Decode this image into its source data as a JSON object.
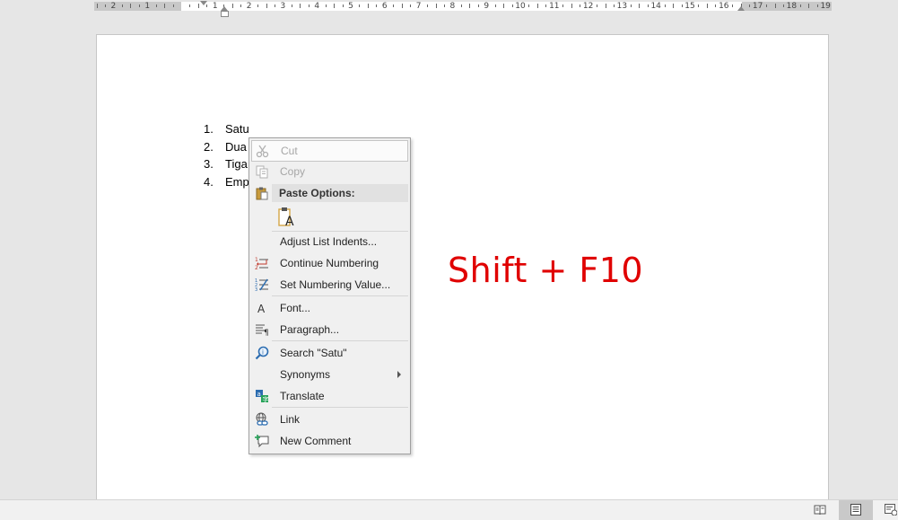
{
  "ruler": {
    "labels": [
      "2",
      "1",
      "1",
      "2",
      "3",
      "4",
      "5",
      "6",
      "7",
      "8",
      "9",
      "10",
      "11",
      "12",
      "13",
      "14",
      "15",
      "16",
      "17",
      "18",
      "19"
    ]
  },
  "document": {
    "list": [
      {
        "num": "1.",
        "text": "Satu"
      },
      {
        "num": "2.",
        "text": "Dua"
      },
      {
        "num": "3.",
        "text": "Tiga"
      },
      {
        "num": "4.",
        "text": "Emp"
      }
    ]
  },
  "annotation": {
    "text": "Shift + F10",
    "color": "#e00000"
  },
  "context_menu": {
    "items": [
      {
        "id": "cut",
        "label": "Cut",
        "icon": "scissors-icon",
        "disabled": true
      },
      {
        "id": "copy",
        "label": "Copy",
        "icon": "copy-icon",
        "disabled": true
      },
      {
        "id": "paste_header",
        "label": "Paste Options:",
        "icon": "clipboard-icon"
      },
      {
        "id": "paste_text_only",
        "label": "",
        "icon": "keep-text-only-icon"
      },
      {
        "id": "adjust",
        "label": "Adjust List Indents...",
        "icon": ""
      },
      {
        "id": "continue",
        "label": "Continue Numbering",
        "icon": "continue-numbering-icon"
      },
      {
        "id": "setvalue",
        "label": "Set Numbering Value...",
        "icon": "set-numbering-value-icon"
      },
      {
        "id": "font",
        "label": "Font...",
        "icon": "font-icon"
      },
      {
        "id": "paragraph",
        "label": "Paragraph...",
        "icon": "paragraph-icon"
      },
      {
        "id": "search",
        "label": "Search \"Satu\"",
        "icon": "search-icon"
      },
      {
        "id": "synonyms",
        "label": "Synonyms",
        "icon": "",
        "submenu": true
      },
      {
        "id": "translate",
        "label": "Translate",
        "icon": "translate-icon"
      },
      {
        "id": "link",
        "label": "Link",
        "icon": "link-icon"
      },
      {
        "id": "comment",
        "label": "New Comment",
        "icon": "new-comment-icon"
      }
    ]
  },
  "status_bar": {
    "buttons": [
      "read-mode-icon",
      "print-layout-icon",
      "web-layout-icon"
    ],
    "active": "print-layout-icon"
  }
}
